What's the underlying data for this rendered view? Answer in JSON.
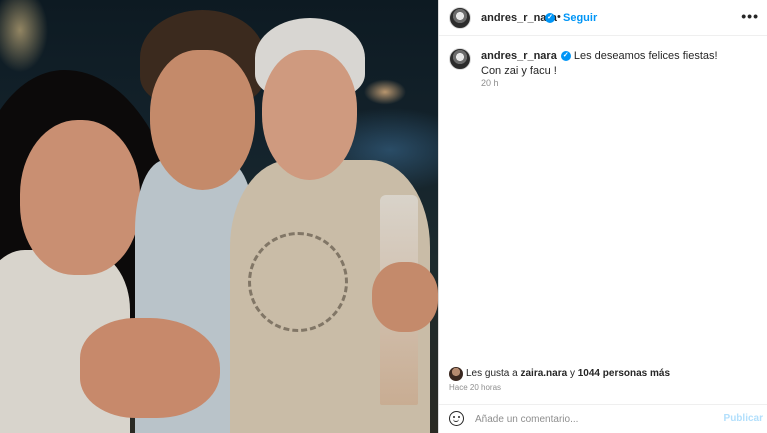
{
  "post": {
    "image_alt": "Foto de tres personas sonriendo de noche junto al agua",
    "username": "andres_r_nara",
    "verified": true,
    "follow_label": "Seguir",
    "separator": "•",
    "more_label": "•••",
    "caption_line1": "Les deseamos felices fiestas!",
    "caption_line2": "Con zai y facu !",
    "caption_time": "20 h"
  },
  "likes": {
    "prefix": "Les gusta a ",
    "user": "zaira.nara",
    "joiner": " y ",
    "count_text": "1044 personas más"
  },
  "posted_ago": "Hace 20 horas",
  "comment": {
    "placeholder": "Añade un comentario...",
    "publish_label": "Publicar"
  },
  "colors": {
    "accent": "#0095f6",
    "publish_disabled": "#b2dffc",
    "text": "#262626",
    "muted": "#8e8e8e"
  },
  "icons": [
    "verified-badge-icon",
    "more-options-icon",
    "emoji-icon"
  ]
}
